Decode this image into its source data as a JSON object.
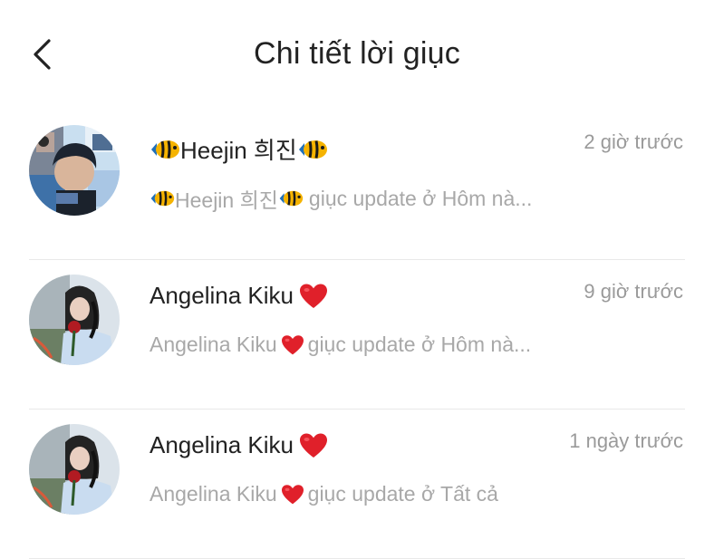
{
  "header": {
    "title": "Chi tiết lời giục",
    "back_icon": "chevron-left-icon"
  },
  "items": [
    {
      "name": "Heejin 희진",
      "name_emoji": "tropical-fish-icon",
      "time": "2 giờ trước",
      "message": "giục update ở Hôm nà...",
      "sender": "Heejin 희진",
      "avatar": "avatar-heejin"
    },
    {
      "name": "Angelina Kiku",
      "name_emoji": "red-heart-icon",
      "time": "9 giờ trước",
      "message": "giục update ở Hôm nà...",
      "sender": "Angelina Kiku",
      "avatar": "avatar-angelina"
    },
    {
      "name": "Angelina Kiku",
      "name_emoji": "red-heart-icon",
      "time": "1 ngày trước",
      "message": "giục update ở Tất cả",
      "sender": "Angelina Kiku",
      "avatar": "avatar-angelina"
    }
  ],
  "colors": {
    "title": "#222222",
    "time": "#9a9a9a",
    "message": "#a8a8a8",
    "divider": "#e9e9e9",
    "heart": "#e0202a",
    "fish": "#f5b300"
  }
}
